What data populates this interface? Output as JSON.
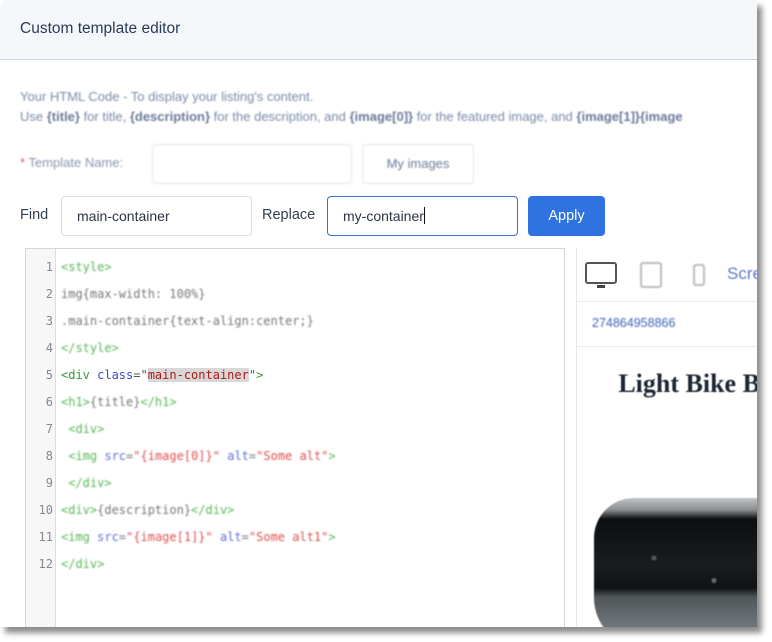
{
  "header": {
    "title": "Custom template editor"
  },
  "description": {
    "line1": "Your HTML Code - To display your listing's content.",
    "line2_parts": [
      "Use ",
      "{title}",
      " for title, ",
      "{description}",
      " for the description, and ",
      "{image[0]}",
      " for the featured image, and ",
      "{image[1]}{image"
    ]
  },
  "template_name": {
    "required_mark": "*",
    "label": "Template Name:",
    "value": "",
    "my_images_label": "My images"
  },
  "find_replace": {
    "find_label": "Find",
    "find_value": "main-container",
    "replace_label": "Replace",
    "replace_value": "my-container",
    "apply_label": "Apply"
  },
  "editor": {
    "lines": [
      {
        "n": "1",
        "tokens": [
          [
            "tag",
            "<style>"
          ]
        ]
      },
      {
        "n": "2",
        "tokens": [
          [
            "plain",
            "img{max-width: 100%}"
          ]
        ]
      },
      {
        "n": "3",
        "tokens": [
          [
            "plain",
            ".main-container{text-align:center;}"
          ]
        ]
      },
      {
        "n": "4",
        "tokens": [
          [
            "tag",
            "</style>"
          ]
        ]
      },
      {
        "n": "5",
        "tokens": [
          [
            "tag",
            "<div "
          ],
          [
            "attr",
            "class"
          ],
          [
            "plain",
            "=\""
          ],
          [
            "str-hl",
            "main-container"
          ],
          [
            "plain",
            "\""
          ],
          [
            "tag",
            ">"
          ]
        ],
        "sharp": true
      },
      {
        "n": "6",
        "tokens": [
          [
            "tag",
            "<h1>"
          ],
          [
            "plain",
            "{title}"
          ],
          [
            "tag",
            "</h1>"
          ]
        ]
      },
      {
        "n": "7",
        "tokens": [
          [
            "plain",
            " "
          ],
          [
            "tag",
            "<div>"
          ]
        ]
      },
      {
        "n": "8",
        "tokens": [
          [
            "plain",
            " "
          ],
          [
            "tag",
            "<img "
          ],
          [
            "attr",
            "src"
          ],
          [
            "plain",
            "="
          ],
          [
            "str",
            "\"{image[0]}\""
          ],
          [
            "plain",
            " "
          ],
          [
            "attr",
            "alt"
          ],
          [
            "plain",
            "="
          ],
          [
            "str",
            "\"Some alt\""
          ],
          [
            "tag",
            ">"
          ]
        ]
      },
      {
        "n": "9",
        "tokens": [
          [
            "plain",
            " "
          ],
          [
            "tag",
            "</div>"
          ]
        ]
      },
      {
        "n": "10",
        "tokens": [
          [
            "tag",
            "<div>"
          ],
          [
            "plain",
            "{description}"
          ],
          [
            "tag",
            "</div>"
          ]
        ]
      },
      {
        "n": "11",
        "tokens": [
          [
            "tag",
            "<img "
          ],
          [
            "attr",
            "src"
          ],
          [
            "plain",
            "="
          ],
          [
            "str",
            "\"{image[1]}\""
          ],
          [
            "plain",
            " "
          ],
          [
            "attr",
            "alt"
          ],
          [
            "plain",
            "="
          ],
          [
            "str",
            "\"Some alt1\""
          ],
          [
            "tag",
            ">"
          ]
        ]
      },
      {
        "n": "12",
        "tokens": [
          [
            "tag",
            "</div>"
          ]
        ]
      }
    ]
  },
  "preview": {
    "devices": [
      "desktop-icon",
      "tablet-icon",
      "phone-icon"
    ],
    "screen_label": "Scre",
    "listing_id": "274864958866",
    "title": "Light Bike B US"
  }
}
